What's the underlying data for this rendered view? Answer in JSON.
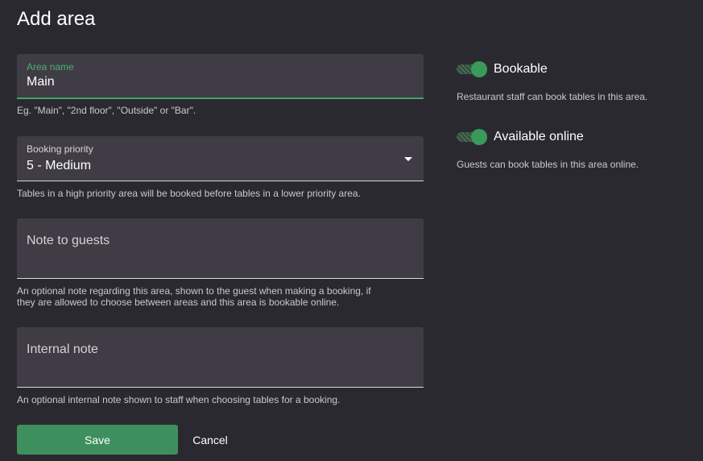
{
  "page": {
    "title": "Add area"
  },
  "form": {
    "area_name": {
      "label": "Area name",
      "value": "Main",
      "helper": "Eg. \"Main\", \"2nd floor\", \"Outside\" or \"Bar\"."
    },
    "booking_priority": {
      "label": "Booking priority",
      "value": "5 - Medium",
      "helper": "Tables in a high priority area will be booked before tables in a lower priority area."
    },
    "note_to_guests": {
      "placeholder": "Note to guests",
      "helper_line1": "An optional note regarding this area, shown to the guest when making a booking, if",
      "helper_line2": "they are allowed to choose between areas and this area is bookable online."
    },
    "internal_note": {
      "placeholder": "Internal note",
      "helper": "An optional internal note shown to staff when choosing tables for a booking."
    }
  },
  "toggles": {
    "bookable": {
      "label": "Bookable",
      "helper": "Restaurant staff can book tables in this area.",
      "on": true
    },
    "available_online": {
      "label": "Available online",
      "helper": "Guests can book tables in this area online.",
      "on": true
    }
  },
  "actions": {
    "save_label": "Save",
    "cancel_label": "Cancel"
  },
  "colors": {
    "background": "#2b2930",
    "field_background": "#3f3c46",
    "accent_green": "#3e8f5e",
    "focus_green": "#3fa567"
  }
}
